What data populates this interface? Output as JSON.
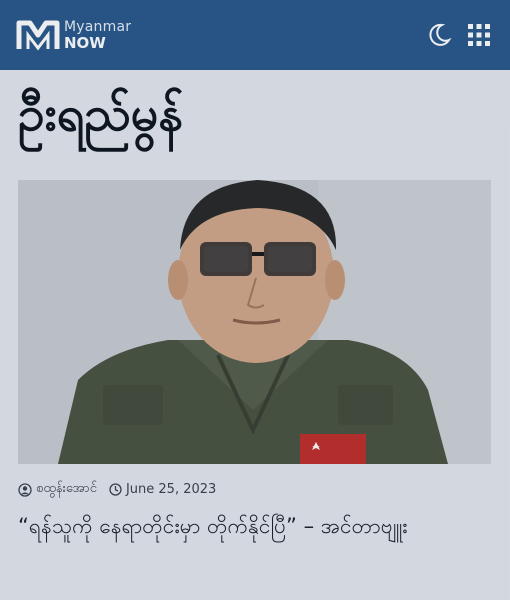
{
  "header": {
    "logo_line1": "Myanmar",
    "logo_line2": "NOW",
    "dark_mode_icon": "moon-icon",
    "menu_icon": "grid-icon"
  },
  "page": {
    "headline": "ဦးရည်မွန်"
  },
  "article": {
    "image_subject": "portrait photo",
    "author": "စထွန်းအောင်",
    "date": "June 25, 2023",
    "title": "“ရန်သူကို နေရာတိုင်းမှာ တိုက်နိုင်ပြီ” – အင်တာဗျူး"
  },
  "colors": {
    "header_bg": "#2a5a8c",
    "page_bg": "#e4e9ef",
    "text": "#1b232d"
  }
}
